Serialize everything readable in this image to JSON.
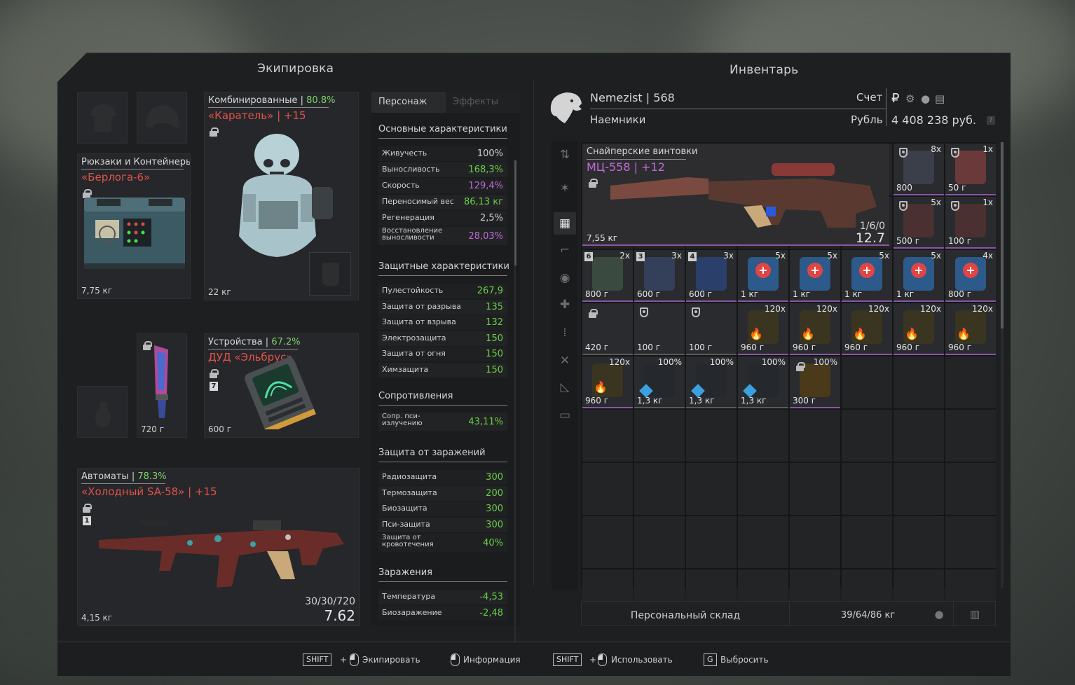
{
  "equipment": {
    "title": "Экипировка",
    "armor": {
      "category": "Комбинированные",
      "percent": "80.8%",
      "name": "«Каратель»",
      "upgrade": "+15",
      "weight": "22 кг"
    },
    "backpack": {
      "category": "Рюкзаки и Контейнеры",
      "name": "«Берлога-6»",
      "weight": "7,75 кг"
    },
    "knife": {
      "weight": "720 г"
    },
    "device": {
      "category": "Устройства",
      "percent": "67.2%",
      "name": "ДУД «Эльбрус»",
      "tag": "7",
      "weight": "600 г"
    },
    "rifle": {
      "category": "Автоматы",
      "percent": "78.3%",
      "name": "«Холодный SA-58»",
      "upgrade": "+15",
      "tag": "1",
      "ammo": "30/30/720",
      "caliber": "7.62",
      "weight": "4,15 кг"
    }
  },
  "stats": {
    "tabs": [
      "Персонаж",
      "Эффекты"
    ],
    "basic": {
      "title": "Основные характеристики",
      "rows": [
        {
          "k": "Живучесть",
          "v": "100%"
        },
        {
          "k": "Выносливость",
          "v": "168,3%"
        },
        {
          "k": "Скорость",
          "v": "129,4%"
        },
        {
          "k": "Переносимый вес",
          "v": "86,13 кг"
        },
        {
          "k": "Регенерация",
          "v": "2,5%"
        },
        {
          "k": "Восстановление выносливости",
          "v": "28,03%"
        }
      ]
    },
    "protect": {
      "title": "Защитные характеристики",
      "rows": [
        {
          "k": "Пулестойкость",
          "v": "267,9"
        },
        {
          "k": "Защита от разрыва",
          "v": "135"
        },
        {
          "k": "Защита от взрыва",
          "v": "132"
        },
        {
          "k": "Электрозащита",
          "v": "150"
        },
        {
          "k": "Защита от огня",
          "v": "150"
        },
        {
          "k": "Химзащита",
          "v": "150"
        }
      ]
    },
    "resist": {
      "title": "Сопротивления",
      "rows": [
        {
          "k": "Сопр. пси-излучению",
          "v": "43,11%"
        }
      ]
    },
    "infect": {
      "title": "Защита от заражений",
      "rows": [
        {
          "k": "Радиозащита",
          "v": "300"
        },
        {
          "k": "Термозащита",
          "v": "200"
        },
        {
          "k": "Биозащита",
          "v": "300"
        },
        {
          "k": "Пси-защита",
          "v": "300"
        },
        {
          "k": "Защита от кровотечения",
          "v": "40%"
        }
      ]
    },
    "contam": {
      "title": "Заражения",
      "rows": [
        {
          "k": "Температура",
          "v": "-4,53"
        },
        {
          "k": "Биозаражение",
          "v": "-2,48"
        }
      ]
    }
  },
  "inventory": {
    "title": "Инвентарь",
    "player": "Nemezist",
    "level": "568",
    "faction": "Наемники",
    "account_label": "Счет",
    "currency_label": "Рубль",
    "money": "4 408 238 руб.",
    "help": "?",
    "weapon": {
      "category": "Снайперские винтовки",
      "name": "МЦ-558",
      "upgrade": "+12",
      "weight": "7,55 кг",
      "ammo": "1/6/0",
      "caliber": "12.7"
    },
    "items": [
      {
        "qty": "8x",
        "price": "800",
        "color": "#3a3f4a"
      },
      {
        "qty": "1x",
        "price": "50 г",
        "color": "#6a3a3a"
      },
      {
        "qty": "5x",
        "price": "500 г",
        "color": "#4a3030"
      },
      {
        "qty": "1x",
        "price": "100 г",
        "color": "#4a3030"
      },
      {
        "qty": "2x",
        "price": "800 г",
        "num": "6",
        "color": "#3a4a40"
      },
      {
        "qty": "3x",
        "price": "600 г",
        "num": "3",
        "color": "#34405a"
      },
      {
        "qty": "3x",
        "price": "600 г",
        "num": "4",
        "color": "#2a3f6a"
      },
      {
        "qty": "5x",
        "price": "1 кг",
        "color": "#2c5a8a"
      },
      {
        "qty": "5x",
        "price": "1 кг",
        "color": "#2c5a8a"
      },
      {
        "qty": "5x",
        "price": "1 кг",
        "color": "#2c5a8a"
      },
      {
        "qty": "5x",
        "price": "1 кг",
        "color": "#2c5a8a"
      },
      {
        "qty": "4x",
        "price": "800 г",
        "color": "#2c5a8a"
      },
      {
        "qty": "",
        "price": "420 г",
        "color": "#2a2b2e"
      },
      {
        "qty": "",
        "price": "100 г",
        "color": "#2a2b2e"
      },
      {
        "qty": "",
        "price": "100 г",
        "color": "#2a2b2e"
      },
      {
        "qty": "120x",
        "price": "960 г",
        "color": "#3a3520"
      },
      {
        "qty": "120x",
        "price": "960 г",
        "color": "#3a3520"
      },
      {
        "qty": "120x",
        "price": "960 г",
        "color": "#3a3520"
      },
      {
        "qty": "120x",
        "price": "960 г",
        "color": "#3a3520"
      },
      {
        "qty": "120x",
        "price": "960 г",
        "color": "#3a3520"
      },
      {
        "qty": "120x",
        "price": "960 г",
        "color": "#3a3520"
      },
      {
        "qty": "100%",
        "price": "1,3 кг",
        "color": "#25282c"
      },
      {
        "qty": "100%",
        "price": "1,3 кг",
        "color": "#25282c"
      },
      {
        "qty": "100%",
        "price": "1,3 кг",
        "color": "#25282c"
      },
      {
        "qty": "100%",
        "price": "300 г",
        "color": "#4a3a1a"
      }
    ],
    "storage_label": "Персональный склад",
    "storage_weight": "39/64/86 кг"
  },
  "footer": {
    "shift1": "SHIFT",
    "equip": "Экипировать",
    "info": "Информация",
    "shift2": "SHIFT",
    "use": "Использовать",
    "g": "G",
    "drop": "Выбросить"
  }
}
